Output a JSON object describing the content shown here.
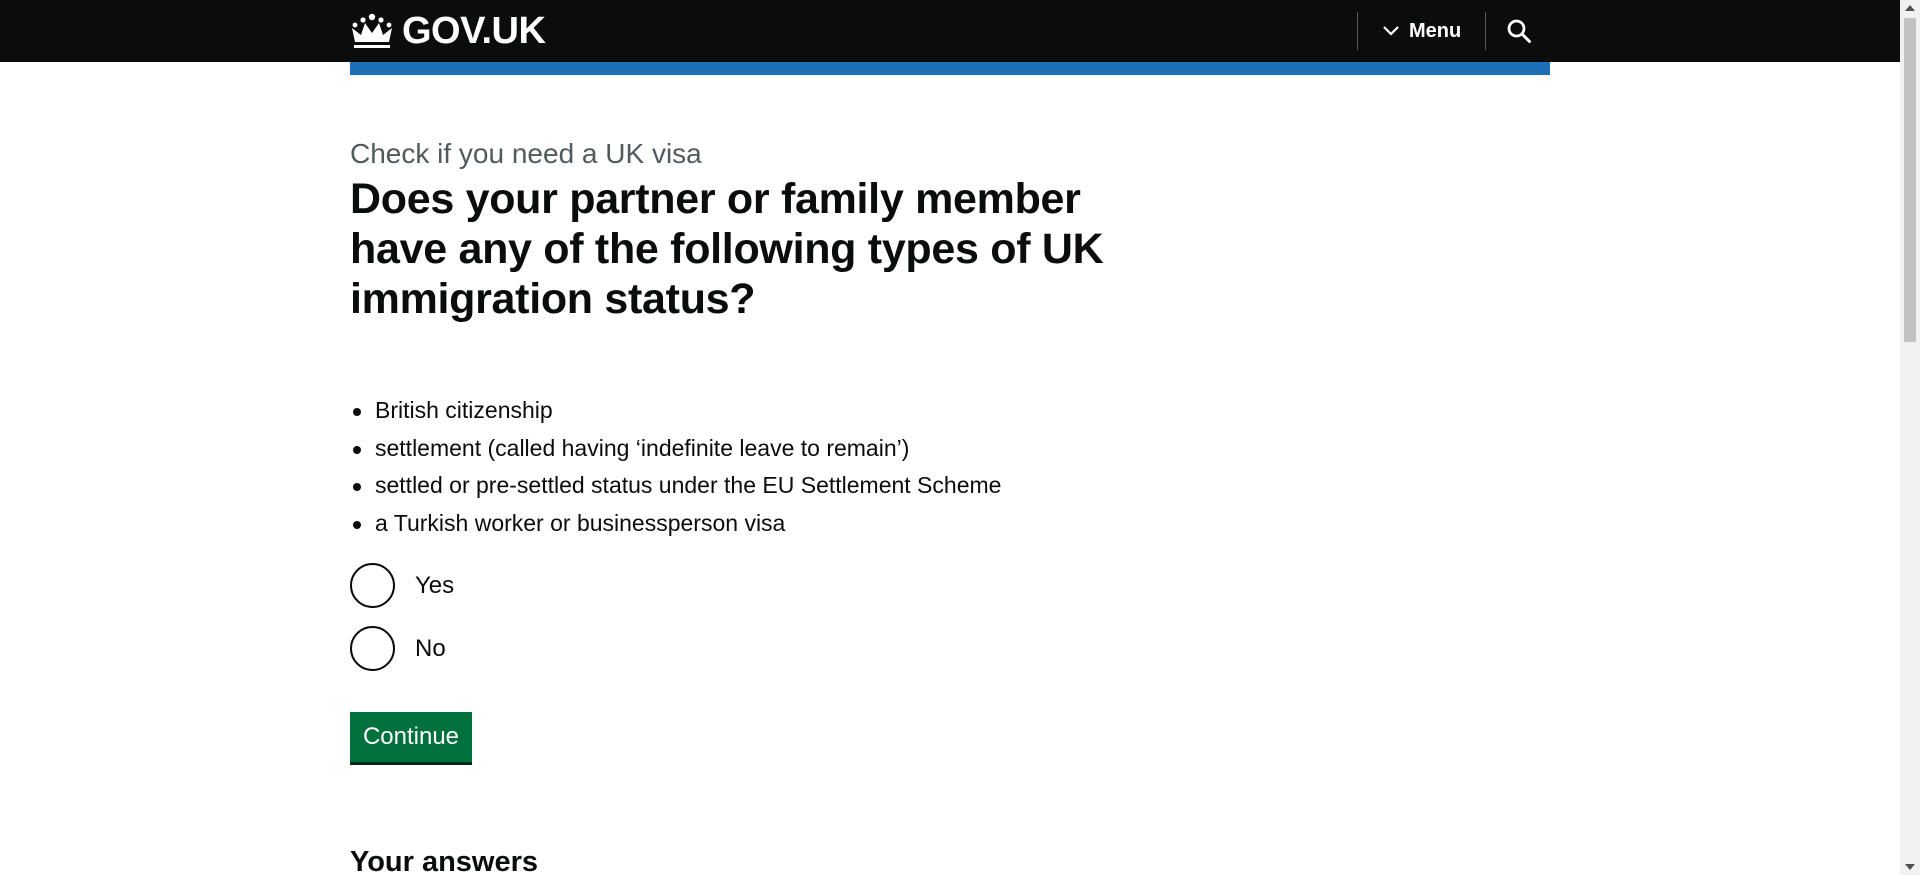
{
  "header": {
    "logo_text": "GOV.UK",
    "menu_label": "Menu",
    "icons": [
      "crown-icon",
      "chevron-down-icon",
      "search-icon"
    ]
  },
  "main": {
    "caption": "Check if you need a UK visa",
    "heading": "Does your partner or family member have any of the following types of UK immigration status?",
    "status_list": [
      "British citizenship",
      "settlement (called having ‘indefinite leave to remain’)",
      "settled or pre-settled status under the EU Settlement Scheme",
      "a Turkish worker or businessperson visa"
    ],
    "options": [
      {
        "label": "Yes",
        "selected": false
      },
      {
        "label": "No",
        "selected": false
      }
    ],
    "continue_label": "Continue",
    "answers_heading": "Your answers"
  },
  "colors": {
    "header_bg": "#0b0c0c",
    "accent_blue": "#1d70b8",
    "button_green": "#00703c",
    "text": "#0b0c0c",
    "secondary_text": "#505a5f"
  }
}
